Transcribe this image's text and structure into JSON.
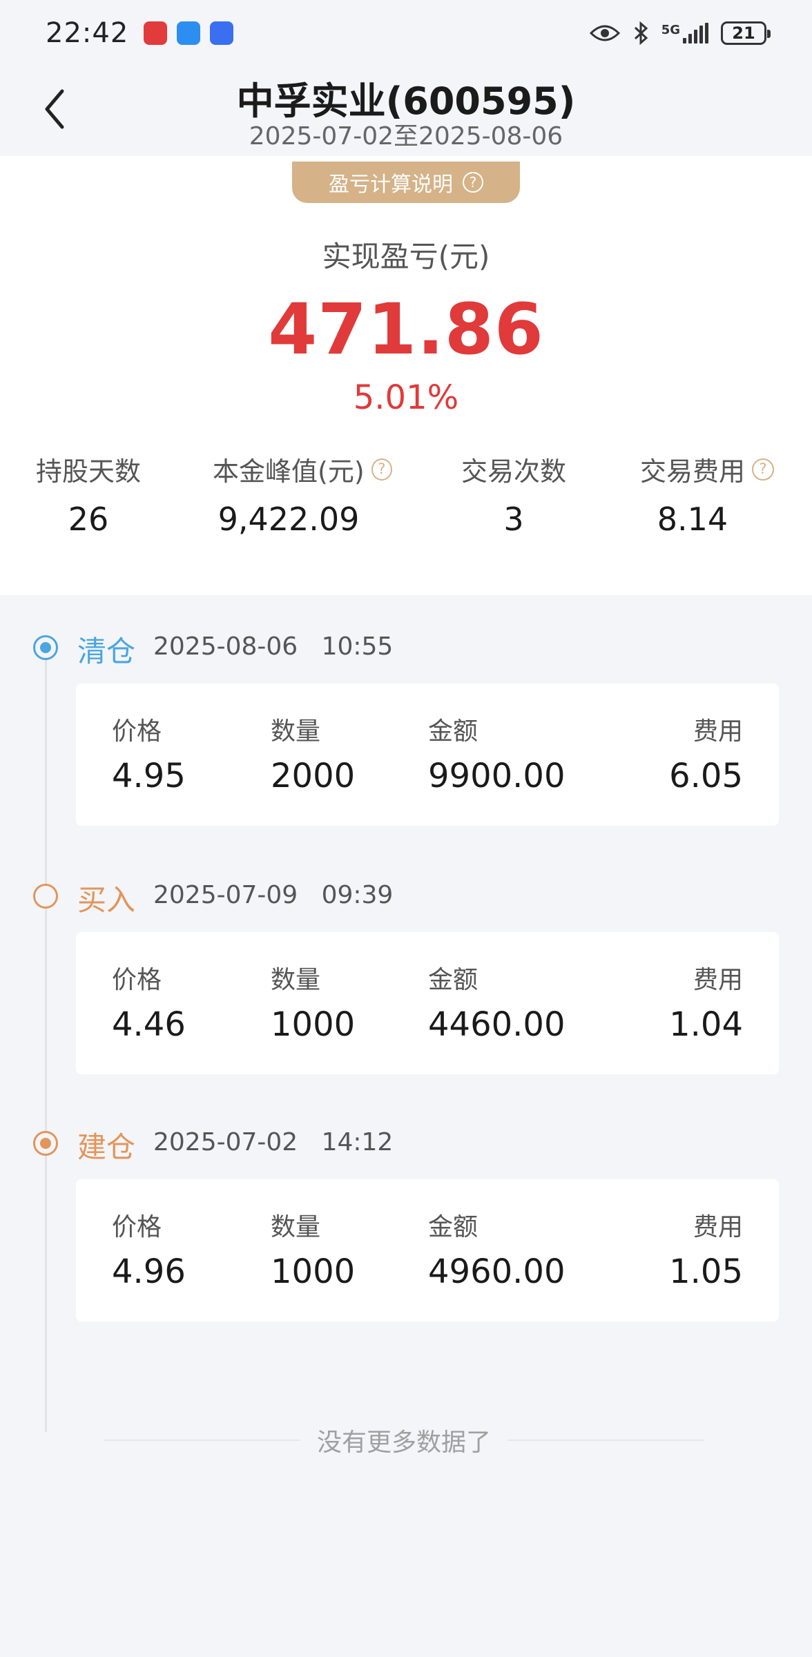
{
  "status_bar": {
    "time": "22:42",
    "network": "5G",
    "battery": "21",
    "icons": [
      "eye-icon",
      "bluetooth-icon",
      "signal-icon",
      "battery-icon"
    ]
  },
  "header": {
    "title": "中孚实业(600595)",
    "date_range": "2025-07-02至2025-08-06"
  },
  "summary": {
    "explain_label": "盈亏计算说明",
    "pnl_label": "实现盈亏(元)",
    "pnl_value": "471.86",
    "pnl_percent": "5.01%",
    "stats": [
      {
        "label": "持股天数",
        "value": "26",
        "help": false
      },
      {
        "label": "本金峰值(元)",
        "value": "9,422.09",
        "help": true
      },
      {
        "label": "交易次数",
        "value": "3",
        "help": false
      },
      {
        "label": "交易费用",
        "value": "8.14",
        "help": true
      }
    ]
  },
  "columns": {
    "price": "价格",
    "qty": "数量",
    "amount": "金额",
    "fee": "费用"
  },
  "events": [
    {
      "type": "清仓",
      "date": "2025-08-06",
      "time": "10:55",
      "price": "4.95",
      "qty": "2000",
      "amount": "9900.00",
      "fee": "6.05"
    },
    {
      "type": "买入",
      "date": "2025-07-09",
      "time": "09:39",
      "price": "4.46",
      "qty": "1000",
      "amount": "4460.00",
      "fee": "1.04"
    },
    {
      "type": "建仓",
      "date": "2025-07-02",
      "time": "14:12",
      "price": "4.96",
      "qty": "1000",
      "amount": "4960.00",
      "fee": "1.05"
    }
  ],
  "colors": {
    "profit_red": "#e03a3a",
    "gold": "#d5b288",
    "clear_blue": "#4aa6e0",
    "buy_orange": "#e3955a"
  },
  "footer": {
    "no_more": "没有更多数据了"
  }
}
